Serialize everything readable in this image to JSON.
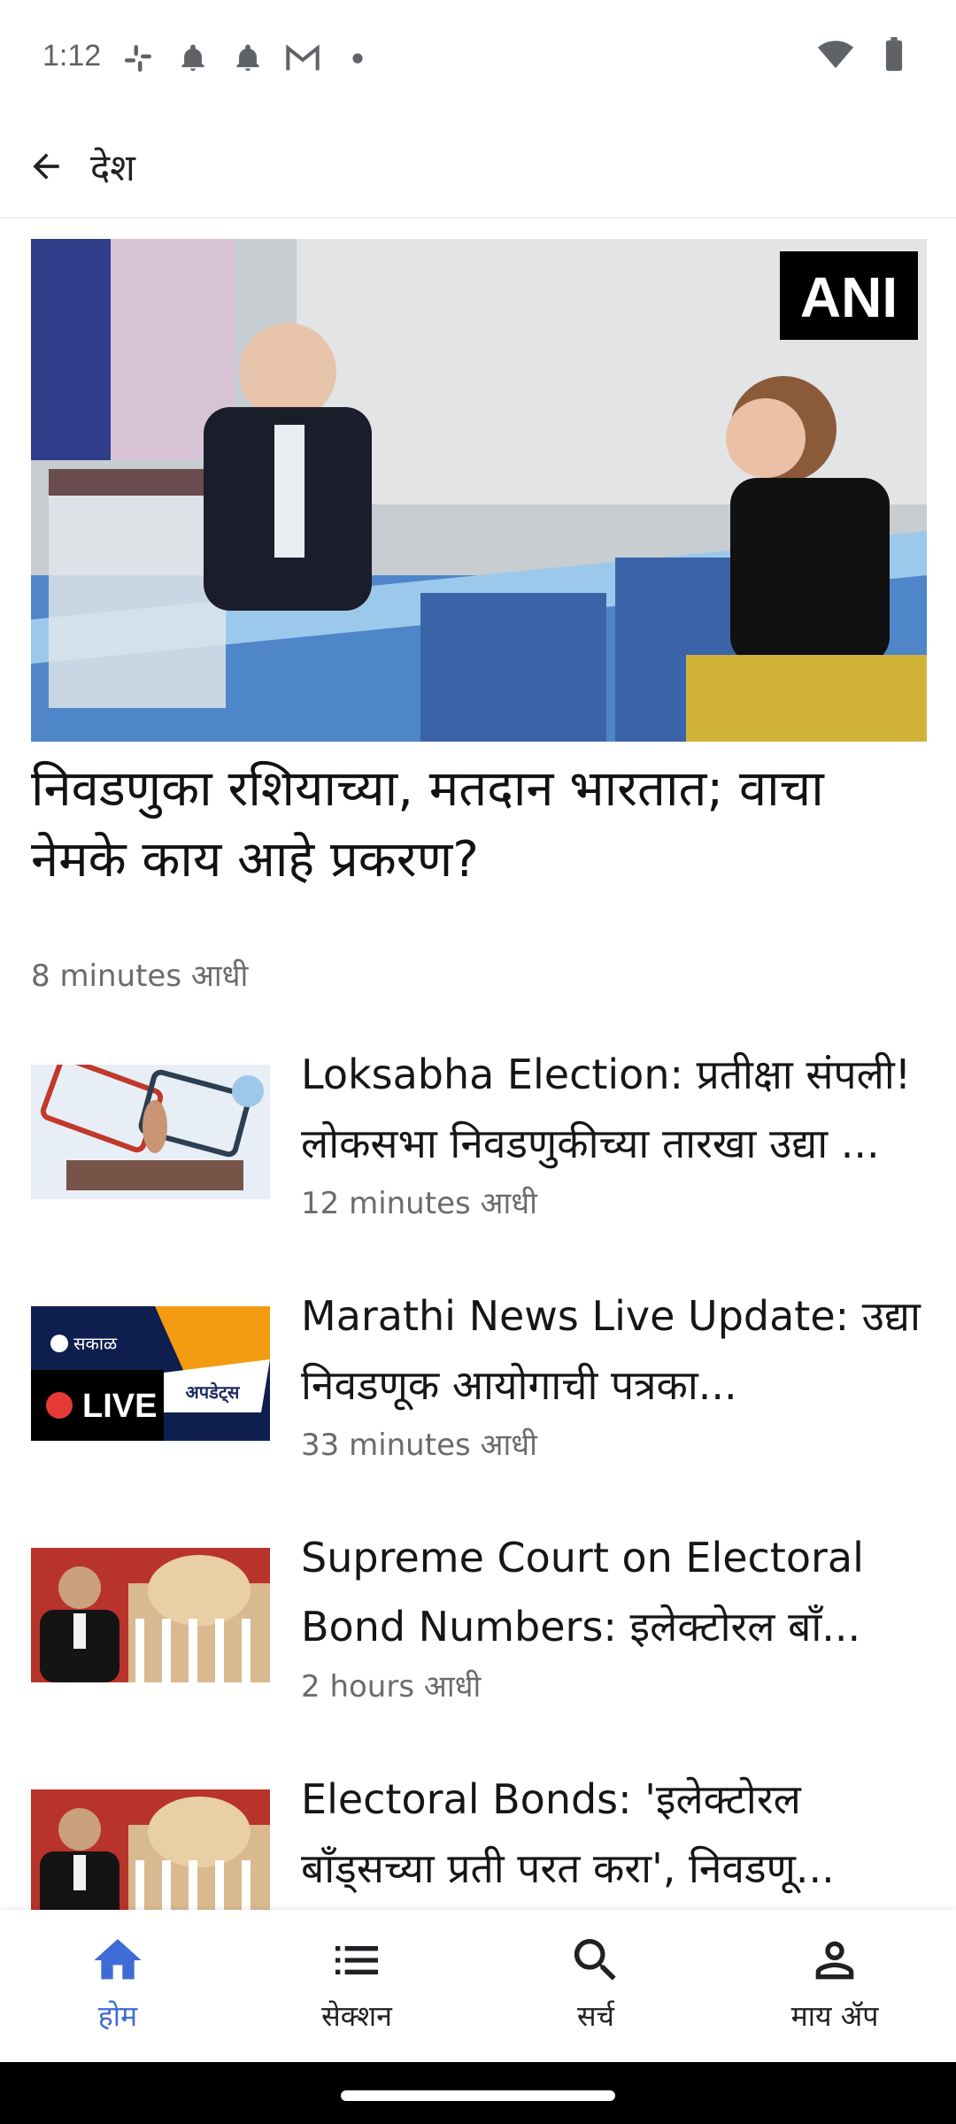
{
  "status_bar": {
    "time": "1:12",
    "left_icons": [
      "slack-icon",
      "notification-bell-icon",
      "notification-bell-icon",
      "gmail-icon",
      "dot-icon"
    ],
    "right_icons": [
      "wifi-icon",
      "battery-icon"
    ]
  },
  "app_bar": {
    "title": "देश",
    "back_icon": "arrow-back-icon"
  },
  "hero": {
    "image_badge": "ANI",
    "title": "निवडणुका रशियाच्या, मतदान भारतात; वाचा नेमके काय आहे प्रकरण?",
    "time": "8 minutes आधी"
  },
  "articles": [
    {
      "title": "Loksabha Election: प्रतीक्षा संपली! लोकसभा निवडणुकीच्या तारखा उद्या ...",
      "time": "12 minutes आधी"
    },
    {
      "title": "Marathi News Live Update: उद्या निवडणूक आयोगाची पत्रका...",
      "time": "33 minutes आधी",
      "badge": "LIVE",
      "thumb_text": "अपडेट्स",
      "thumb_brand": "सकाळ"
    },
    {
      "title": "Supreme Court on Electoral Bond Numbers: इलेक्टोरल बाँ...",
      "time": "2 hours आधी"
    },
    {
      "title": "Electoral Bonds: 'इलेक्टोरल बाँड्सच्या प्रती परत करा', निवडणू..."
    }
  ],
  "bottom_nav": [
    {
      "label": "होम",
      "icon": "home-icon",
      "active": true
    },
    {
      "label": "सेक्शन",
      "icon": "list-icon",
      "active": false
    },
    {
      "label": "सर्च",
      "icon": "search-icon",
      "active": false
    },
    {
      "label": "माय ॲप",
      "icon": "person-icon",
      "active": false
    }
  ],
  "colors": {
    "accent": "#3f6bd6",
    "live_red": "#e53935"
  }
}
